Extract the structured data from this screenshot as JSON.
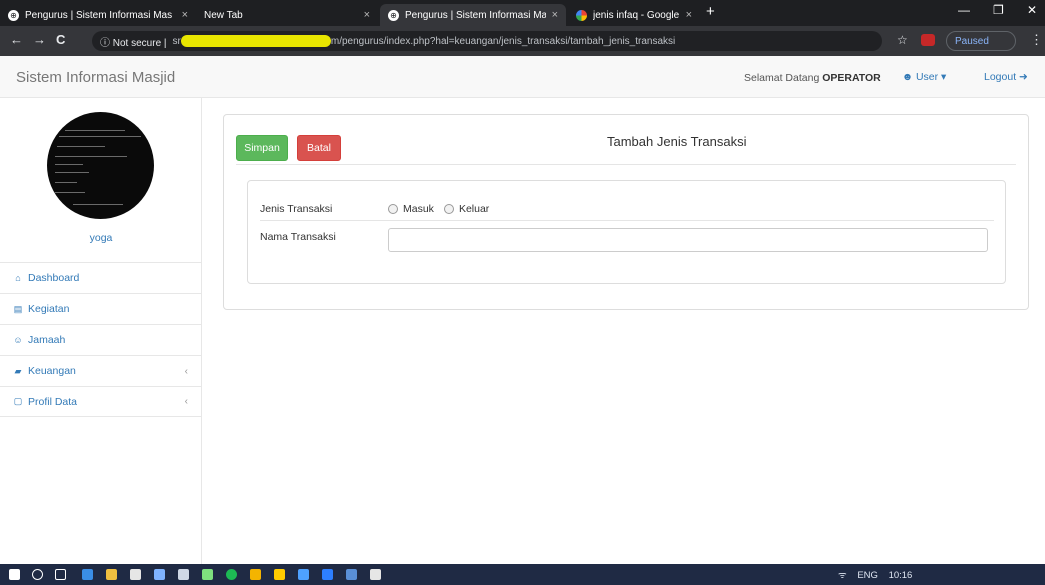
{
  "browser": {
    "tabs": [
      {
        "title": "Pengurus | Sistem Informasi Mas",
        "icon": "globe-icon",
        "active": false
      },
      {
        "title": "New Tab",
        "icon": "",
        "active": false
      },
      {
        "title": "Pengurus | Sistem Informasi Mas",
        "icon": "globe-icon",
        "active": true
      },
      {
        "title": "jenis infaq - Google Search",
        "icon": "google-icon",
        "active": false
      }
    ],
    "tab_close": "×",
    "new_tab": "+",
    "window_controls": {
      "minimize": "—",
      "maximize": "❐",
      "close": "✕"
    },
    "nav": {
      "back": "←",
      "forward": "→",
      "reload": "C"
    },
    "security_label": "ⓘ Not secure |",
    "url_prefix": "sr",
    "url_path": "m/pengurus/index.php?hal=keuangan/jenis_transaksi/tambah_jenis_transaksi",
    "star": "☆",
    "paused_label": "Paused",
    "menu": "⋮"
  },
  "app": {
    "brand": "Sistem Informasi Masjid",
    "welcome_prefix": "Selamat Datang",
    "welcome_role": "OPERATOR",
    "user_menu": "User ▾",
    "logout": "Logout ➜"
  },
  "sidebar": {
    "username": "yoga",
    "items": [
      {
        "icon": "home-icon",
        "glyph": "⌂",
        "label": "Dashboard",
        "has_caret": false
      },
      {
        "icon": "list-icon",
        "glyph": "▤",
        "label": "Kegiatan",
        "has_caret": false
      },
      {
        "icon": "users-icon",
        "glyph": "☺",
        "label": "Jamaah",
        "has_caret": false
      },
      {
        "icon": "book-icon",
        "glyph": "▰",
        "label": "Keuangan",
        "has_caret": true
      },
      {
        "icon": "file-icon",
        "glyph": "▢",
        "label": "Profil Data",
        "has_caret": true
      }
    ],
    "caret": "‹"
  },
  "form": {
    "save_label": "Simpan",
    "cancel_label": "Batal",
    "title": "Tambah Jenis Transaksi",
    "jenis_label": "Jenis Transaksi",
    "option_masuk": "Masuk",
    "option_keluar": "Keluar",
    "nama_label": "Nama Transaksi",
    "nama_value": ""
  },
  "taskbar": {
    "tray_network": "ᯤ",
    "tray_lang": "ENG",
    "tray_time": "10:16"
  },
  "colors": {
    "primary": "#337ab7",
    "success": "#5cb85c",
    "danger": "#d9534f",
    "chrome_dark": "#35363a"
  }
}
